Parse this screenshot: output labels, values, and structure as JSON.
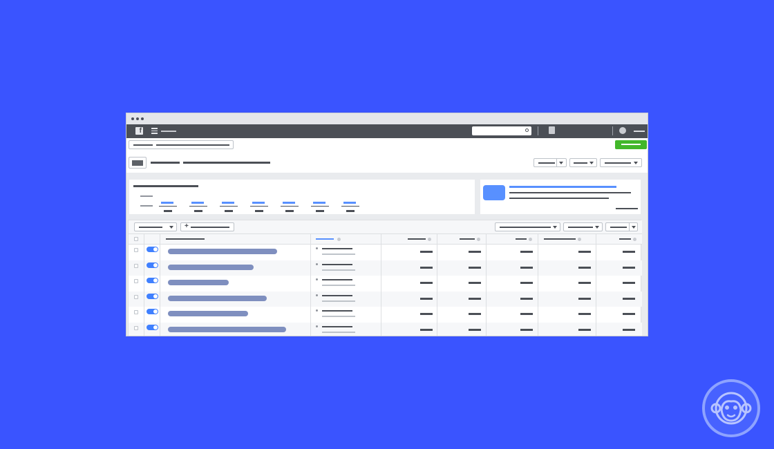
{
  "window": {
    "title": ""
  },
  "topbar": {
    "brand": "facebook-icon",
    "search_placeholder": ""
  },
  "page": {
    "primary_action": "",
    "view_title": ""
  },
  "table": {
    "rows": [
      {
        "toggle": "on"
      },
      {
        "toggle": "on"
      },
      {
        "toggle": "on"
      },
      {
        "toggle": "on"
      },
      {
        "toggle": "on"
      },
      {
        "toggle": "on"
      }
    ]
  },
  "colors": {
    "background": "#3a54ff",
    "accent": "#5890ff",
    "primary_button": "#42b72a",
    "nav_bar": "#4b4f56"
  }
}
